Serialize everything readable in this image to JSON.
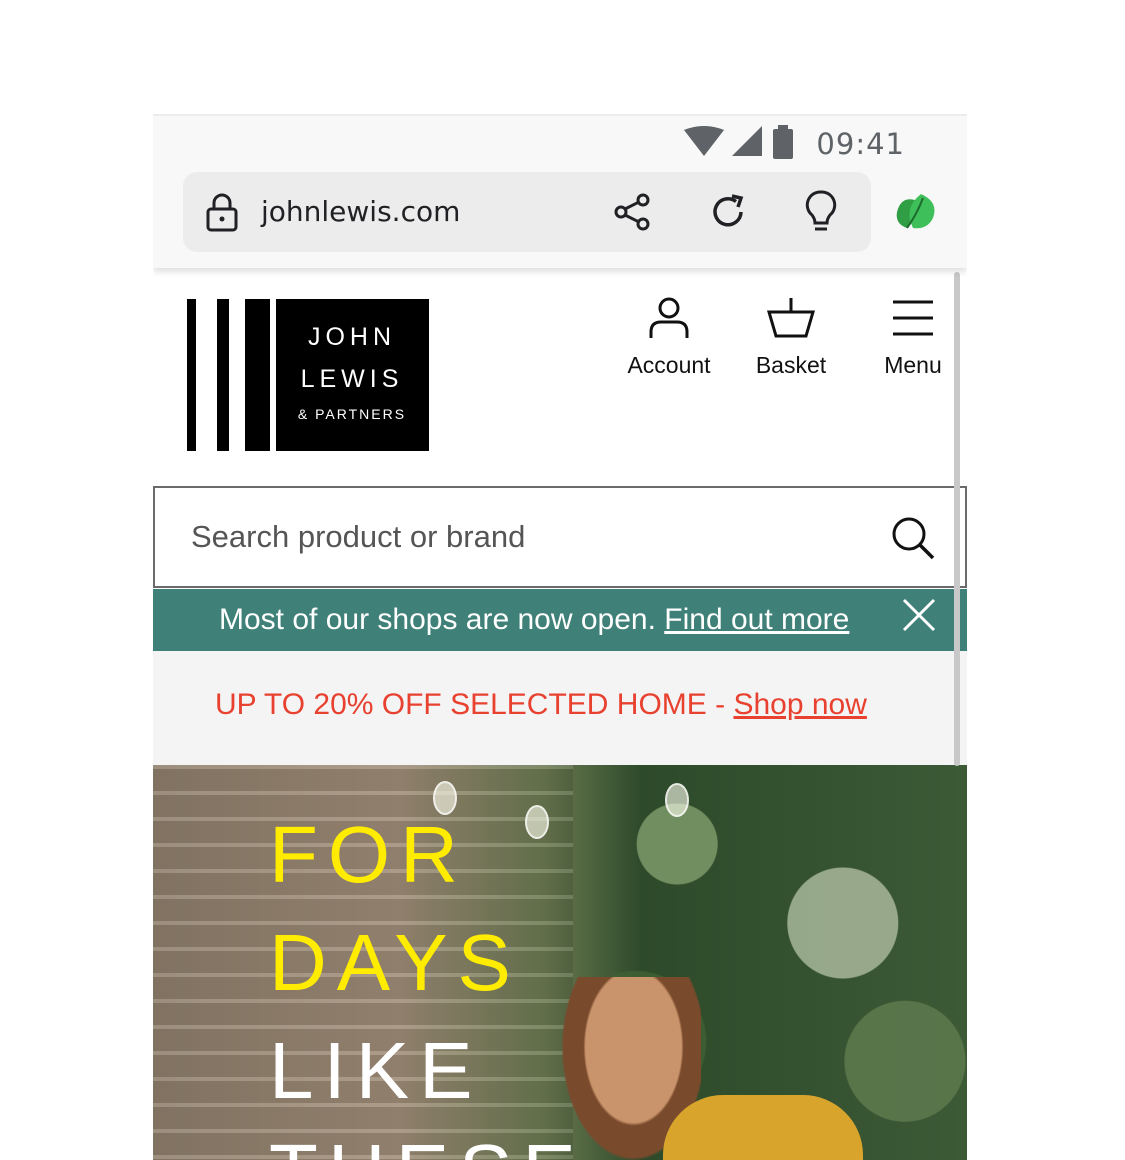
{
  "status_bar": {
    "time": "09:41"
  },
  "browser": {
    "url": "johnlewis.com"
  },
  "header": {
    "logo": {
      "line1": "JOHN",
      "line2": "LEWIS",
      "line3": "& PARTNERS"
    },
    "nav": [
      {
        "label": "Account",
        "icon": "person-icon"
      },
      {
        "label": "Basket",
        "icon": "basket-icon"
      },
      {
        "label": "Menu",
        "icon": "hamburger-icon"
      }
    ]
  },
  "search": {
    "placeholder": "Search product or brand"
  },
  "notice": {
    "text": "Most of our shops are now open. ",
    "link": "Find out more"
  },
  "promo": {
    "text": "UP TO 20% OFF SELECTED HOME - ",
    "link": "Shop now"
  },
  "hero": {
    "lines": [
      "FOR",
      "DAYS",
      "LIKE",
      "THESE"
    ]
  },
  "colors": {
    "notice_bg": "#3f8178",
    "promo_text": "#e8412f",
    "hero_yellow": "#ffec00"
  }
}
